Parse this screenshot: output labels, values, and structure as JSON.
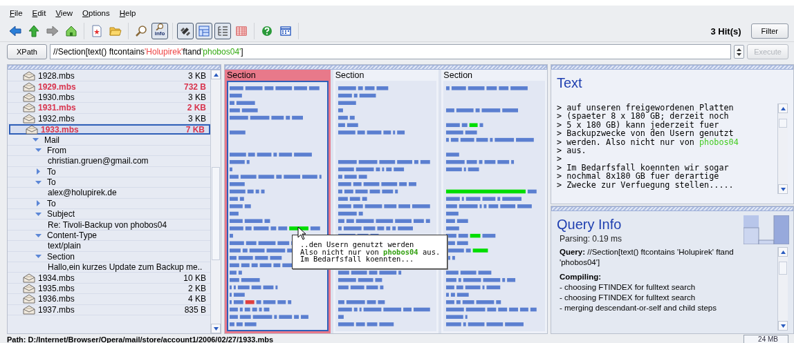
{
  "menu": [
    {
      "label": "File"
    },
    {
      "label": "Edit"
    },
    {
      "label": "View"
    },
    {
      "label": "Options"
    },
    {
      "label": "Help"
    }
  ],
  "toolbar": {
    "groups": [
      [
        {
          "kind": "back",
          "pressed": false
        },
        {
          "kind": "up",
          "pressed": false
        },
        {
          "kind": "forward",
          "pressed": false
        },
        {
          "kind": "home",
          "pressed": false
        }
      ],
      [
        {
          "kind": "new",
          "pressed": false
        },
        {
          "kind": "open",
          "pressed": false
        }
      ],
      [
        {
          "kind": "search",
          "pressed": false
        },
        {
          "kind": "info",
          "pressed": true,
          "label": "info"
        }
      ],
      [
        {
          "kind": "explore",
          "pressed": true
        },
        {
          "kind": "map",
          "pressed": true
        },
        {
          "kind": "tree",
          "pressed": true
        },
        {
          "kind": "table",
          "pressed": false
        }
      ],
      [
        {
          "kind": "help",
          "pressed": false
        },
        {
          "kind": "grid",
          "pressed": false
        }
      ]
    ],
    "hits": "3 Hit(s)",
    "filter_button": "Filter"
  },
  "query_bar": {
    "mode_button": "XPath",
    "segments": [
      {
        "text": "//Section[text() ftcontains "
      },
      {
        "text": "'Holupirek'",
        "color": "#ee4444"
      },
      {
        "text": " ftand "
      },
      {
        "text": "'phobos04'",
        "color": "#33aa11"
      },
      {
        "text": "]"
      }
    ],
    "execute_button": "Execute",
    "execute_disabled": true
  },
  "tree": [
    {
      "kind": "file",
      "name": "1928.mbs",
      "size": "3 KB",
      "hit": false,
      "selected": false
    },
    {
      "kind": "file",
      "name": "1929.mbs",
      "size": "732 B",
      "hit": true,
      "selected": false
    },
    {
      "kind": "file",
      "name": "1930.mbs",
      "size": "3 KB",
      "hit": false,
      "selected": false
    },
    {
      "kind": "file",
      "name": "1931.mbs",
      "size": "2 KB",
      "hit": true,
      "selected": false
    },
    {
      "kind": "file",
      "name": "1932.mbs",
      "size": "3 KB",
      "hit": false,
      "selected": false
    },
    {
      "kind": "file",
      "name": "1933.mbs",
      "size": "7 KB",
      "hit": true,
      "selected": true,
      "children": [
        {
          "kind": "element",
          "label": "Mail",
          "expanded": true,
          "children": [
            {
              "kind": "element",
              "label": "From",
              "expanded": true,
              "children": [
                {
                  "kind": "text",
                  "label": "christian.gruen@gmail.com"
                }
              ]
            },
            {
              "kind": "element",
              "label": "To",
              "expanded": false
            },
            {
              "kind": "element",
              "label": "To",
              "expanded": true,
              "children": [
                {
                  "kind": "text",
                  "label": "alex@holupirek.de"
                }
              ]
            },
            {
              "kind": "element",
              "label": "To",
              "expanded": false
            },
            {
              "kind": "element",
              "label": "Subject",
              "expanded": true,
              "children": [
                {
                  "kind": "text",
                  "label": "Re: Tivoli-Backup von phobos04"
                }
              ]
            },
            {
              "kind": "element",
              "label": "Content-Type",
              "expanded": true,
              "children": [
                {
                  "kind": "text",
                  "label": "text/plain"
                }
              ]
            },
            {
              "kind": "element",
              "label": "Section",
              "expanded": true,
              "children": [
                {
                  "kind": "text",
                  "label": "Hallo,ein kurzes Update zum Backup me.."
                }
              ]
            }
          ]
        }
      ]
    },
    {
      "kind": "file",
      "name": "1934.mbs",
      "size": "10 KB",
      "hit": false,
      "selected": false
    },
    {
      "kind": "file",
      "name": "1935.mbs",
      "size": "2 KB",
      "hit": false,
      "selected": false
    },
    {
      "kind": "file",
      "name": "1936.mbs",
      "size": "4 KB",
      "hit": false,
      "selected": false
    },
    {
      "kind": "file",
      "name": "1937.mbs",
      "size": "835 B",
      "hit": false,
      "selected": false
    }
  ],
  "map": {
    "sections": [
      {
        "label": "Section",
        "selected": true
      },
      {
        "label": "Section",
        "selected": false
      },
      {
        "label": "Section",
        "selected": false
      }
    ],
    "tooltip": [
      "..den Usern genutzt werden",
      "Also nicht nur von **phobos04** aus.",
      "Im Bedarfsfall koennten..."
    ]
  },
  "text_panel": {
    "title": "Text",
    "lines": [
      [
        {
          "text": "> auf unseren freigewordenen Platten",
          "hit": false
        }
      ],
      [
        {
          "text": "> (spaeter 8 x 180 GB; derzeit noch",
          "hit": false
        }
      ],
      [
        {
          "text": "> 5 x 180 GB) kann jederzeit fuer",
          "hit": false
        }
      ],
      [
        {
          "text": "> Backupzwecke von den Usern genutzt",
          "hit": false
        }
      ],
      [
        {
          "text": "> werden. Also nicht nur von ",
          "hit": false
        },
        {
          "text": "phobos04",
          "hit": true
        }
      ],
      [
        {
          "text": "> aus.",
          "hit": false
        }
      ],
      [
        {
          "text": ">",
          "hit": false
        }
      ],
      [
        {
          "text": "> Im Bedarfsfall koennten wir sogar",
          "hit": false
        }
      ],
      [
        {
          "text": "> nochmal 8x180 GB fuer derartige",
          "hit": false
        }
      ],
      [
        {
          "text": "> Zwecke zur Verfuegung stellen.....",
          "hit": false
        }
      ]
    ]
  },
  "query_info": {
    "title": "Query Info",
    "parsing": "Parsing: 0.19 ms",
    "query": "**Query:** //Section[text() ftcontains 'Holupirek' ftand 'phobos04']",
    "compiling_heading": "Compiling:",
    "compiling": [
      "- choosing FTINDEX for fulltext search",
      "- choosing FTINDEX for fulltext search",
      "- merging descendant-or-self and child steps"
    ]
  },
  "status_bar": {
    "path": "Path: D:/Internet/Browser/Opera/mail/store/account1/2006/02/27/1933.mbs",
    "memory": "24 MB"
  }
}
